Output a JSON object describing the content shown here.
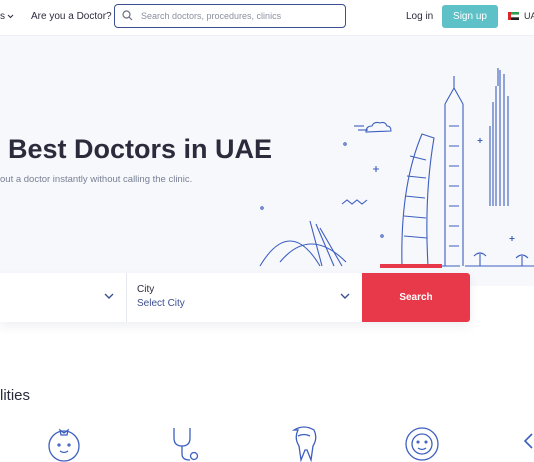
{
  "header": {
    "nav_partial": "s",
    "nav_doctor": "Are you a Doctor?",
    "search_placeholder": "Search doctors, procedures, clinics",
    "login": "Log in",
    "signup": "Sign up",
    "lang_partial": "UA"
  },
  "hero": {
    "title": "Best Doctors in UAE",
    "subtitle": "out a doctor instantly without calling the clinic."
  },
  "search_form": {
    "city_label": "City",
    "city_value": "Select City",
    "search_button": "Search"
  },
  "specialties": {
    "title_partial": "lities",
    "icons": [
      "baby-icon",
      "stethoscope-icon",
      "tooth-icon",
      "face-icon",
      "chevron-left-icon"
    ]
  },
  "colors": {
    "accent": "#5dc1c7",
    "primary": "#3d4f91",
    "search_red": "#e8394a"
  }
}
